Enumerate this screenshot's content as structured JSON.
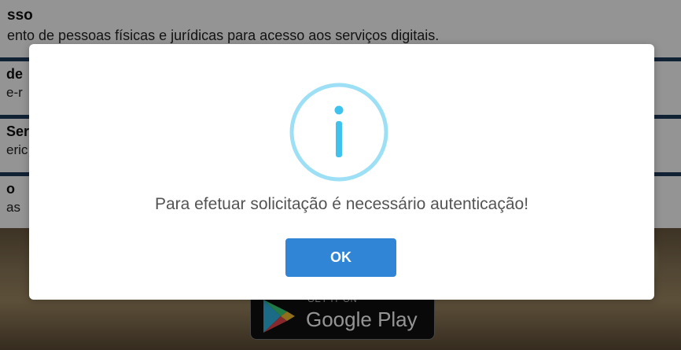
{
  "background": {
    "header": {
      "title": "sso",
      "description": "ento de pessoas físicas e jurídicas para acesso aos serviços digitais."
    },
    "cards": [
      {
        "title": "de",
        "description": "e-r"
      },
      {
        "title": "Ser",
        "description": "eric"
      },
      {
        "title": "o",
        "description": "as"
      }
    ],
    "google_play": {
      "small_label": "GET IT ON",
      "big_label": "Google Play"
    }
  },
  "dialog": {
    "icon": "info-icon",
    "message": "Para efetuar solicitação é necessário autenticação!",
    "ok_label": "OK"
  },
  "colors": {
    "icon_ring": "#9de0f6",
    "icon_glyph": "#3fc3ee",
    "ok_button": "#3085d6",
    "card_border": "#1f3b5c"
  }
}
